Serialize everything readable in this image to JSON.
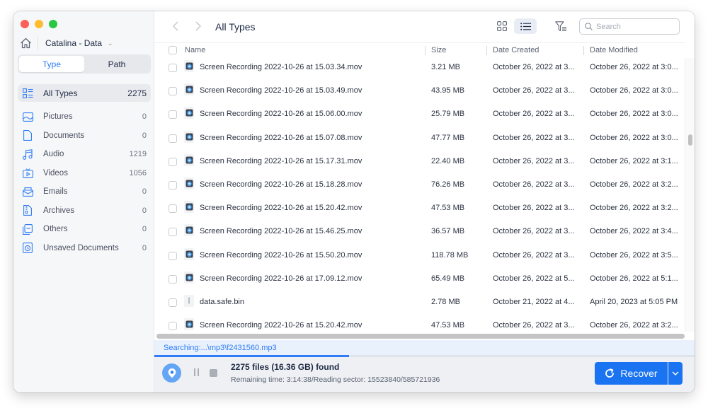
{
  "window": {
    "traffic_lights": [
      "close",
      "minimize",
      "zoom"
    ]
  },
  "sidebar": {
    "drive_name": "Catalina - Data",
    "tabs": [
      {
        "label": "Type",
        "active": true
      },
      {
        "label": "Path",
        "active": false
      }
    ],
    "items": [
      {
        "label": "All Types",
        "count": "2275",
        "icon": "all-types-icon",
        "selected": true
      },
      {
        "label": "Pictures",
        "count": "0",
        "icon": "picture-icon"
      },
      {
        "label": "Documents",
        "count": "0",
        "icon": "document-icon"
      },
      {
        "label": "Audio",
        "count": "1219",
        "icon": "music-icon"
      },
      {
        "label": "Videos",
        "count": "1056",
        "icon": "video-icon"
      },
      {
        "label": "Emails",
        "count": "0",
        "icon": "email-icon"
      },
      {
        "label": "Archives",
        "count": "0",
        "icon": "archive-icon"
      },
      {
        "label": "Others",
        "count": "0",
        "icon": "others-icon"
      },
      {
        "label": "Unsaved Documents",
        "count": "0",
        "icon": "unsaved-document-icon"
      }
    ]
  },
  "header": {
    "title": "All Types",
    "search_placeholder": "Search",
    "view_mode": "list"
  },
  "table": {
    "columns": [
      "Name",
      "Size",
      "Date Created",
      "Date Modified"
    ],
    "rows": [
      {
        "name": "Screen Recording 2022-10-26 at 15.03.34.mov",
        "size": "3.21 MB",
        "created": "October 26, 2022 at 3...",
        "modified": "October 26, 2022 at 3:0...",
        "type": "video"
      },
      {
        "name": "Screen Recording 2022-10-26 at 15.03.49.mov",
        "size": "43.95 MB",
        "created": "October 26, 2022 at 3...",
        "modified": "October 26, 2022 at 3:0...",
        "type": "video"
      },
      {
        "name": "Screen Recording 2022-10-26 at 15.06.00.mov",
        "size": "25.79 MB",
        "created": "October 26, 2022 at 3...",
        "modified": "October 26, 2022 at 3:0...",
        "type": "video"
      },
      {
        "name": "Screen Recording 2022-10-26 at 15.07.08.mov",
        "size": "47.77 MB",
        "created": "October 26, 2022 at 3...",
        "modified": "October 26, 2022 at 3:0...",
        "type": "video"
      },
      {
        "name": "Screen Recording 2022-10-26 at 15.17.31.mov",
        "size": "22.40 MB",
        "created": "October 26, 2022 at 3...",
        "modified": "October 26, 2022 at 3:1...",
        "type": "video"
      },
      {
        "name": "Screen Recording 2022-10-26 at 15.18.28.mov",
        "size": "76.26 MB",
        "created": "October 26, 2022 at 3...",
        "modified": "October 26, 2022 at 3:2...",
        "type": "video"
      },
      {
        "name": "Screen Recording 2022-10-26 at 15.20.42.mov",
        "size": "47.53 MB",
        "created": "October 26, 2022 at 3...",
        "modified": "October 26, 2022 at 3:2...",
        "type": "video"
      },
      {
        "name": "Screen Recording 2022-10-26 at 15.46.25.mov",
        "size": "36.57 MB",
        "created": "October 26, 2022 at 3...",
        "modified": "October 26, 2022 at 3:4...",
        "type": "video"
      },
      {
        "name": "Screen Recording 2022-10-26 at 15.50.20.mov",
        "size": "118.78 MB",
        "created": "October 26, 2022 at 3...",
        "modified": "October 26, 2022 at 3:5...",
        "type": "video"
      },
      {
        "name": "Screen Recording 2022-10-26 at 17.09.12.mov",
        "size": "65.49 MB",
        "created": "October 26, 2022 at 5...",
        "modified": "October 26, 2022 at 5:1...",
        "type": "video"
      },
      {
        "name": "data.safe.bin",
        "size": "2.78 MB",
        "created": "October 21, 2022 at 4...",
        "modified": "April 20, 2023 at 5:05 PM",
        "type": "binary"
      },
      {
        "name": "Screen Recording 2022-10-26 at 15.20.42.mov",
        "size": "47.53 MB",
        "created": "October 26, 2022 at 3...",
        "modified": "October 26, 2022 at 3:2...",
        "type": "video"
      }
    ]
  },
  "status": {
    "searching_text": "Searching:...\\mp3\\f2431560.mp3",
    "progress_percent": 36,
    "found_text": "2275 files (16.36 GB) found",
    "remaining_text": "Remaining time: 3:14:38/Reading sector: 15523840/585721936"
  },
  "footer": {
    "recover_label": "Recover"
  },
  "colors": {
    "accent": "#2f7cf6",
    "recover_button": "#1a73f0"
  }
}
